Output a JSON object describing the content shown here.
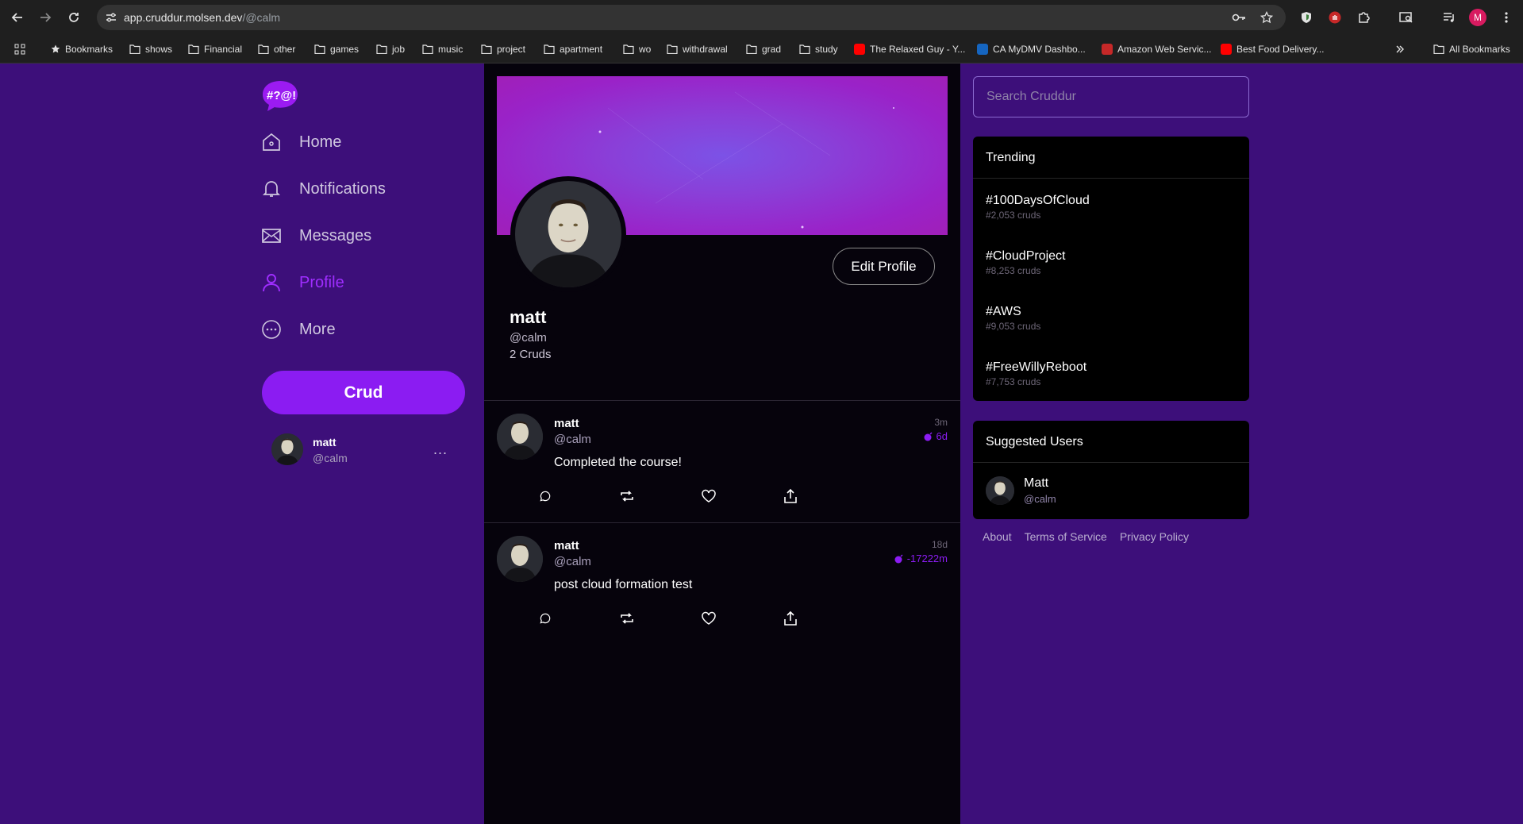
{
  "browser": {
    "url_host": "app.cruddur.molsen.dev",
    "url_path": "/@calm",
    "profile_initial": "M",
    "bookmarks": [
      {
        "label": "Bookmarks",
        "type": "star"
      },
      {
        "label": "shows",
        "type": "folder"
      },
      {
        "label": "Financial",
        "type": "folder"
      },
      {
        "label": "other",
        "type": "folder"
      },
      {
        "label": "games",
        "type": "folder"
      },
      {
        "label": "job",
        "type": "folder"
      },
      {
        "label": "music",
        "type": "folder"
      },
      {
        "label": "project",
        "type": "folder"
      },
      {
        "label": "apartment",
        "type": "folder"
      },
      {
        "label": "wo",
        "type": "folder"
      },
      {
        "label": "withdrawal",
        "type": "folder"
      },
      {
        "label": "grad",
        "type": "folder"
      },
      {
        "label": "study",
        "type": "folder"
      },
      {
        "label": "The Relaxed Guy - Y...",
        "type": "youtube"
      },
      {
        "label": "CA MyDMV Dashbo...",
        "type": "dmv"
      },
      {
        "label": "Amazon Web Servic...",
        "type": "aws"
      },
      {
        "label": "Best Food Delivery...",
        "type": "youtube"
      }
    ],
    "all_bookmarks": "All Bookmarks",
    "colors": {
      "chrome": "#1f1f1f",
      "omnibox": "#333333"
    }
  },
  "app": {
    "logo_text": "#?@!",
    "nav": [
      {
        "label": "Home",
        "icon": "home-icon"
      },
      {
        "label": "Notifications",
        "icon": "bell-icon"
      },
      {
        "label": "Messages",
        "icon": "mail-icon"
      },
      {
        "label": "Profile",
        "icon": "profile-icon",
        "active": true
      },
      {
        "label": "More",
        "icon": "more-icon"
      }
    ],
    "crud_button": "Crud",
    "current_user": {
      "name": "matt",
      "handle": "@calm",
      "menu": "..."
    },
    "colors": {
      "sidebar_bg": "#3d0f7a",
      "accent": "#8b1cf2",
      "feed_bg": "#06030c"
    }
  },
  "profile": {
    "name": "matt",
    "handle": "@calm",
    "count": "2 Cruds",
    "edit_button": "Edit Profile"
  },
  "posts": [
    {
      "name": "matt",
      "handle": "@calm",
      "text": "Completed the course!",
      "time": "3m",
      "expires": "6d"
    },
    {
      "name": "matt",
      "handle": "@calm",
      "text": "post cloud formation test",
      "time": "18d",
      "expires": "-17222m"
    }
  ],
  "sidebar_right": {
    "search_placeholder": "Search Cruddur",
    "trending_title": "Trending",
    "trending": [
      {
        "tag": "#100DaysOfCloud",
        "count": "#2,053 cruds"
      },
      {
        "tag": "#CloudProject",
        "count": "#8,253 cruds"
      },
      {
        "tag": "#AWS",
        "count": "#9,053 cruds"
      },
      {
        "tag": "#FreeWillyReboot",
        "count": "#7,753 cruds"
      }
    ],
    "suggested_title": "Suggested Users",
    "suggested": [
      {
        "name": "Matt",
        "handle": "@calm"
      }
    ],
    "footer": [
      "About",
      "Terms of Service",
      "Privacy Policy"
    ]
  }
}
